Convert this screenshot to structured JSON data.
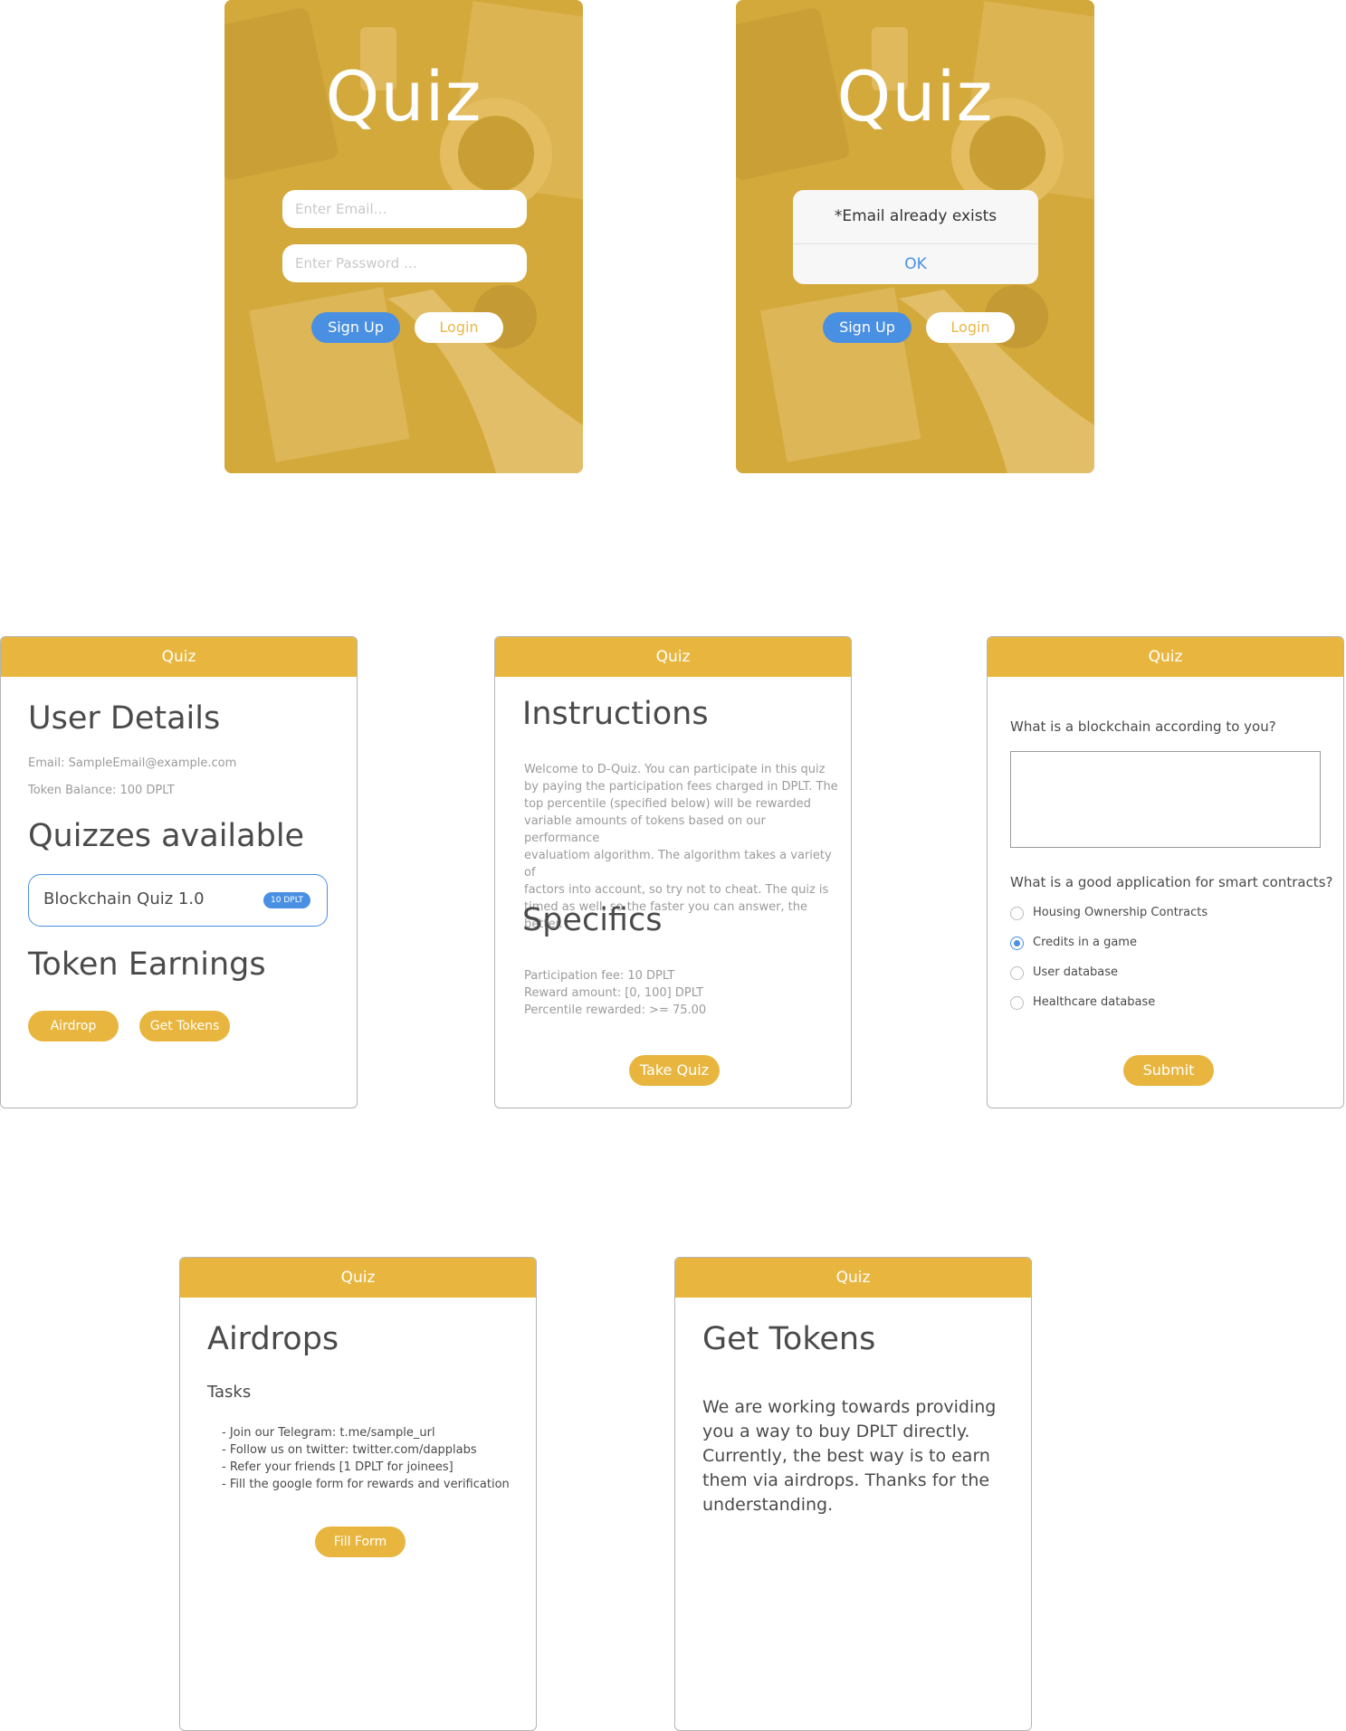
{
  "colors": {
    "gold": "#e8b63f",
    "blue": "#4a90e2",
    "login_bg": "#d4a93c"
  },
  "login": {
    "title": "Quiz",
    "email_placeholder": "Enter Email…",
    "password_placeholder": "Enter Password …",
    "signup_label": "Sign Up",
    "login_label": "Login"
  },
  "login_error": {
    "title": "Quiz",
    "alert_message": "*Email already exists",
    "alert_ok": "OK",
    "signup_label": "Sign Up",
    "login_label": "Login"
  },
  "user_details": {
    "header": "Quiz",
    "heading": "User Details",
    "email": "Email: SampleEmail@example.com",
    "balance": "Token Balance: 100 DPLT",
    "quizzes_heading": "Quizzes available",
    "quiz_name": "Blockchain Quiz 1.0",
    "quiz_badge": "10 DPLT",
    "earnings_heading": "Token Earnings",
    "airdrop_label": "Airdrop",
    "get_tokens_label": "Get Tokens"
  },
  "instructions": {
    "header": "Quiz",
    "heading": "Instructions",
    "lines": [
      "Welcome to D-Quiz. You can participate in this quiz",
      "by paying the participation fees charged in DPLT. The",
      "top percentile (specified below) will be rewarded",
      "variable amounts of tokens based on our performance",
      "evaluatiom algorithm. The algorithm takes a variety of",
      "factors into account, so try not to cheat. The quiz is",
      "timed as well, so the faster you can answer, the better."
    ],
    "specifics_heading": "Specifics",
    "fee": "Participation fee: 10 DPLT",
    "reward": "Reward amount: [0, 100] DPLT",
    "percentile": "Percentile rewarded: >= 75.00",
    "take_quiz_label": "Take Quiz"
  },
  "question": {
    "header": "Quiz",
    "q1": "What is a blockchain according to you?",
    "q2": "What is a good application for smart contracts?",
    "options": [
      "Housing Ownership Contracts",
      "Credits in a game",
      "User database",
      "Healthcare database"
    ],
    "selected_index": 1,
    "submit_label": "Submit"
  },
  "airdrops": {
    "header": "Quiz",
    "heading": "Airdrops",
    "tasks_heading": "Tasks",
    "tasks": [
      "- Join our Telegram: t.me/sample_url",
      "- Follow us on twitter: twitter.com/dapplabs",
      "- Refer your friends [1 DPLT for joinees]",
      "- Fill the google form for rewards and verification"
    ],
    "fill_form_label": "Fill Form"
  },
  "get_tokens": {
    "header": "Quiz",
    "heading": "Get Tokens",
    "lines": [
      "We are working towards providing",
      "you a way to buy DPLT directly.",
      "Currently, the best way is to earn",
      "them via airdrops. Thanks for the",
      "understanding."
    ]
  }
}
